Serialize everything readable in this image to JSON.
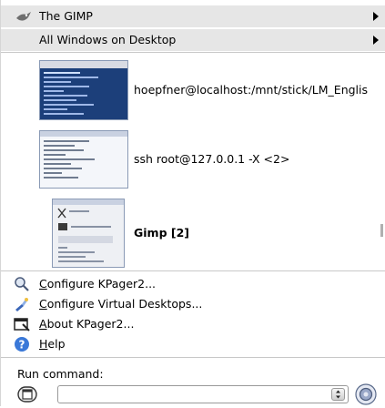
{
  "header": {
    "app_title": "The GIMP",
    "all_windows_label": "All Windows on Desktop"
  },
  "windows": [
    {
      "label": "hoepfner@localhost:/mnt/stick/LM_Englis"
    },
    {
      "label": "ssh root@127.0.0.1 -X <2>"
    },
    {
      "label": "Gimp [2]"
    }
  ],
  "actions": [
    {
      "pre": "",
      "mnemonic": "C",
      "post": "onfigure KPager2...",
      "icon": "magnifier-icon"
    },
    {
      "pre": "",
      "mnemonic": "C",
      "post": "onfigure Virtual Desktops...",
      "icon": "desktop-config-icon"
    },
    {
      "pre": "",
      "mnemonic": "A",
      "post": "bout KPager2...",
      "icon": "about-window-icon"
    },
    {
      "pre": "",
      "mnemonic": "H",
      "post": "elp",
      "icon": "help-icon"
    }
  ],
  "run_command": {
    "label": "Run command:",
    "value": ""
  },
  "icons": {
    "gimp": "gimp-icon",
    "left_button": "window-frame-icon",
    "right_button": "run-gear-icon"
  }
}
